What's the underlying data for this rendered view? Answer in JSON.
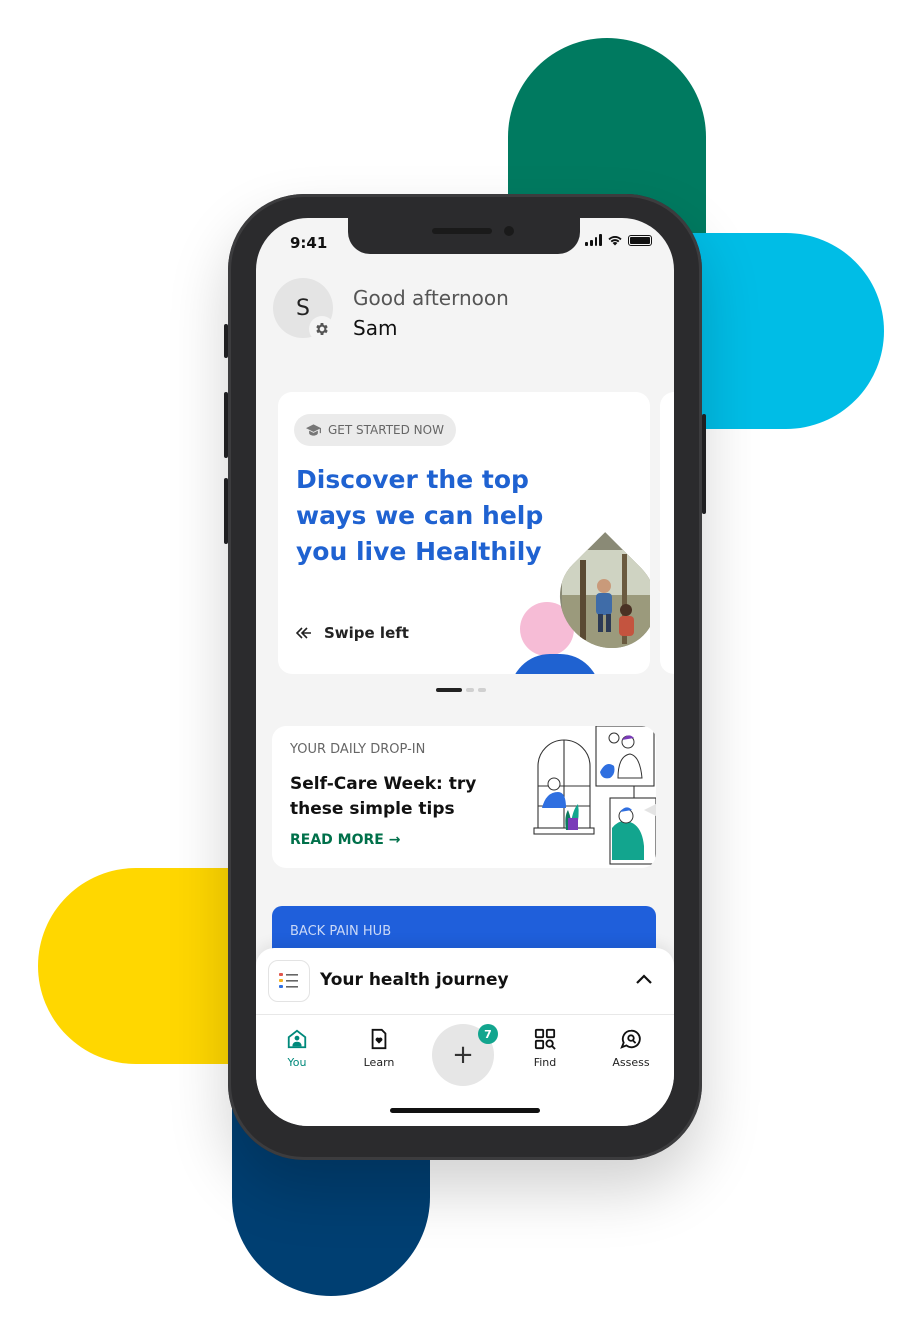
{
  "colors": {
    "green": "#007a60",
    "cyan": "#00bde6",
    "yellow": "#ffd700",
    "navy": "#003f72",
    "primary_blue": "#1f62d1",
    "teal": "#00897b"
  },
  "status_bar": {
    "time": "9:41"
  },
  "header": {
    "avatar_initial": "S",
    "greeting": "Good afternoon",
    "name": "Sam",
    "settings_icon": "gear-icon"
  },
  "hero_card": {
    "chip_icon": "graduation-cap-icon",
    "chip_label": "GET STARTED NOW",
    "title": "Discover the top ways we can help you live Healthily",
    "swipe_icon": "double-arrow-left-icon",
    "swipe_label": "Swipe left"
  },
  "carousel": {
    "pages": 3,
    "active_page": 1
  },
  "daily_card": {
    "eyebrow": "YOUR DAILY DROP-IN",
    "title": "Self-Care Week: try these simple tips",
    "cta": "READ MORE →"
  },
  "hub_card": {
    "label": "BACK PAIN HUB"
  },
  "journey": {
    "icon": "checklist-icon",
    "label": "Your health journey",
    "toggle_icon": "chevron-up-icon"
  },
  "bottom_nav": {
    "items": [
      {
        "label": "You",
        "icon": "home-person-icon",
        "active": true
      },
      {
        "label": "Learn",
        "icon": "book-heart-icon",
        "active": false
      },
      {
        "label": "Find",
        "icon": "grid-search-icon",
        "active": false
      },
      {
        "label": "Assess",
        "icon": "chat-search-icon",
        "active": false
      }
    ],
    "fab_symbol": "+",
    "fab_badge": "7"
  }
}
